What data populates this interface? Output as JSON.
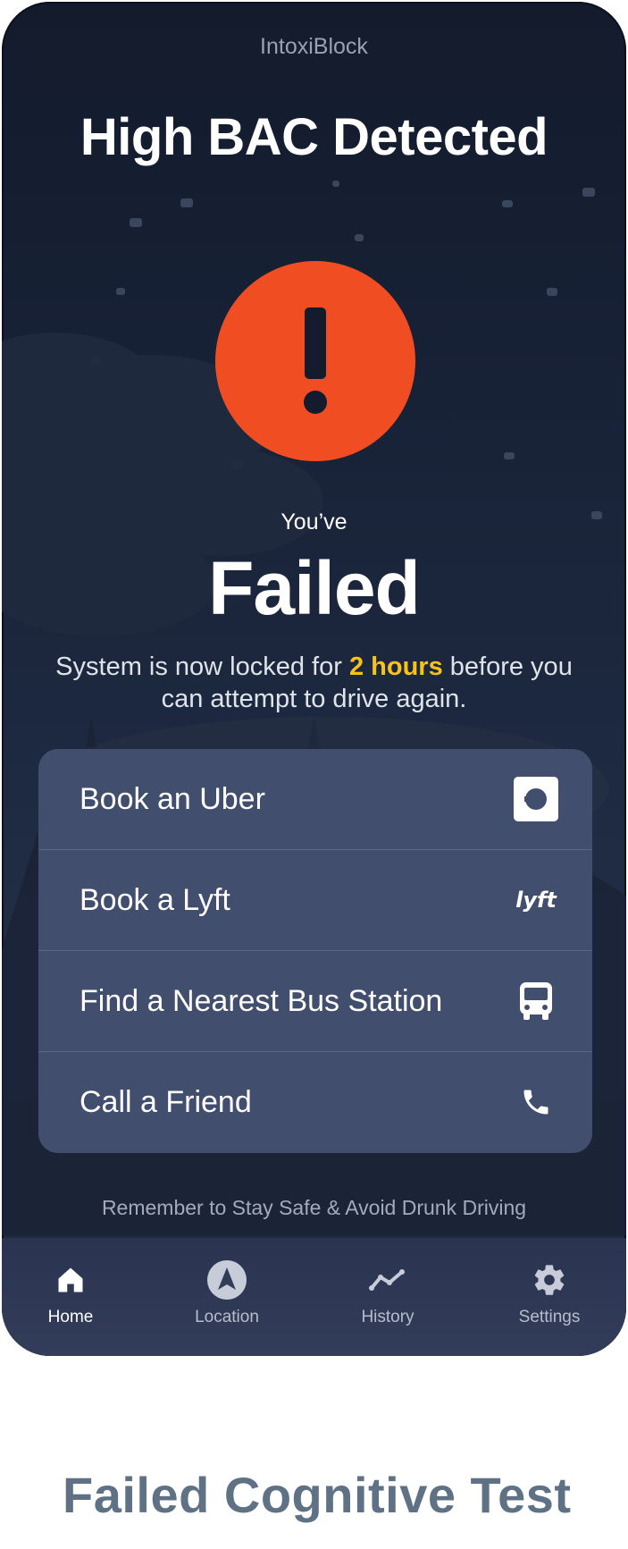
{
  "app": {
    "name": "IntoxiBlock"
  },
  "alert": {
    "headline": "High BAC Detected",
    "icon": "exclamation-icon",
    "accent_color": "#f04e22"
  },
  "result": {
    "prefix": "You’ve",
    "status": "Failed",
    "lock_message_before": "System is now locked for ",
    "lock_duration": "2 hours",
    "lock_message_after": " before you can attempt to drive again.",
    "highlight_color": "#f6c21b"
  },
  "options": [
    {
      "label": "Book an Uber",
      "icon": "uber-icon"
    },
    {
      "label": "Book a Lyft",
      "icon": "lyft-icon"
    },
    {
      "label": "Find a Nearest Bus Station",
      "icon": "bus-icon"
    },
    {
      "label": "Call a Friend",
      "icon": "phone-icon"
    }
  ],
  "reminder": "Remember to Stay Safe & Avoid Drunk Driving",
  "nav": {
    "items": [
      {
        "label": "Home",
        "icon": "home-icon",
        "active": true
      },
      {
        "label": "Location",
        "icon": "location-icon",
        "active": false
      },
      {
        "label": "History",
        "icon": "history-icon",
        "active": false
      },
      {
        "label": "Settings",
        "icon": "gear-icon",
        "active": false
      }
    ]
  },
  "caption": "Failed Cognitive Test"
}
